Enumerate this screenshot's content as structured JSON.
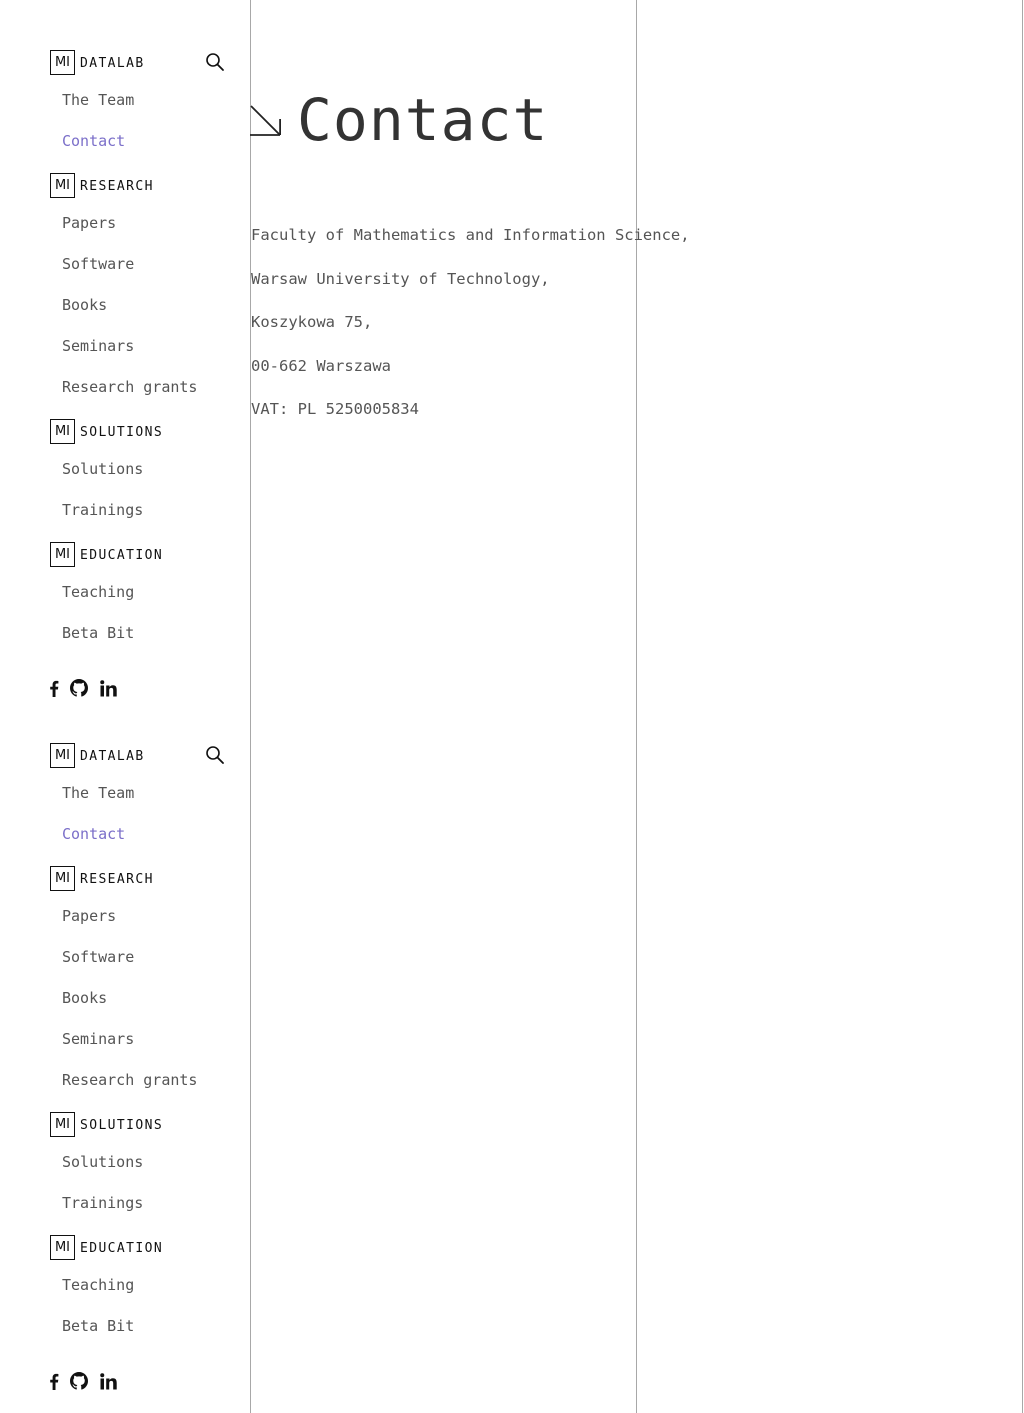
{
  "page": {
    "title": "Contact"
  },
  "address": [
    "Faculty of Mathematics and Information Science,",
    "Warsaw University of Technology,",
    "Koszykowa 75,",
    "00-662 Warszawa",
    "VAT: PL 5250005834"
  ],
  "brand": {
    "logo_text": "MI"
  },
  "sidebar": {
    "sections": [
      {
        "title": "DATALAB",
        "items": [
          {
            "label": "The Team"
          },
          {
            "label": "Contact",
            "active": true
          }
        ]
      },
      {
        "title": "RESEARCH",
        "items": [
          {
            "label": "Papers"
          },
          {
            "label": "Software"
          },
          {
            "label": "Books"
          },
          {
            "label": "Seminars"
          },
          {
            "label": "Research grants"
          }
        ]
      },
      {
        "title": "SOLUTIONS",
        "items": [
          {
            "label": "Solutions"
          },
          {
            "label": "Trainings"
          }
        ]
      },
      {
        "title": "EDUCATION",
        "items": [
          {
            "label": "Teaching"
          },
          {
            "label": "Beta Bit"
          }
        ]
      }
    ],
    "socials": [
      "facebook-icon",
      "github-icon",
      "linkedin-icon"
    ]
  },
  "colors": {
    "active_link": "#7b6fc9",
    "text": "#555555",
    "divider": "#a8a8a8"
  }
}
